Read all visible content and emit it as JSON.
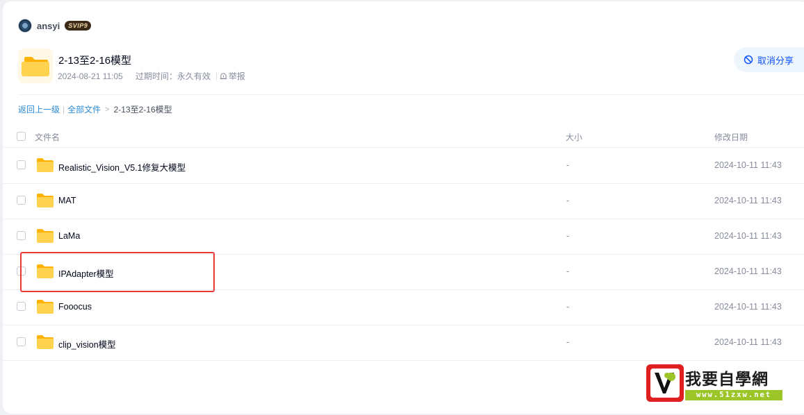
{
  "user": {
    "name": "ansyi",
    "vip_badge": "SVIP9"
  },
  "share": {
    "title": "2-13至2-16模型",
    "date": "2024-08-21 11:05",
    "expire": "过期时间：永久有效",
    "report": "举报",
    "cancel_label": "取消分享"
  },
  "breadcrumb": {
    "back": "返回上一级",
    "all_files": "全部文件",
    "current": "2-13至2-16模型"
  },
  "table": {
    "columns": {
      "name": "文件名",
      "size": "大小",
      "date": "修改日期"
    },
    "rows": [
      {
        "name": "Realistic_Vision_V5.1修复大模型",
        "size": "-",
        "date": "2024-10-11 11:43"
      },
      {
        "name": "MAT",
        "size": "-",
        "date": "2024-10-11 11:43"
      },
      {
        "name": "LaMa",
        "size": "-",
        "date": "2024-10-11 11:43"
      },
      {
        "name": "IPAdapter模型",
        "size": "-",
        "date": "2024-10-11 11:43"
      },
      {
        "name": "Fooocus",
        "size": "-",
        "date": "2024-10-11 11:43"
      },
      {
        "name": "clip_vision模型",
        "size": "-",
        "date": "2024-10-11 11:43"
      }
    ]
  },
  "watermark": {
    "text": "我要自學網",
    "url": "www.51zxw.net"
  },
  "colors": {
    "accent": "#0d53ff",
    "link": "#2a8bd8",
    "folder": "#ffc53d",
    "highlight_box": "#e53935"
  },
  "icons": {
    "avatar": "avatar-image",
    "folder": "folder-icon",
    "cancel": "ban-icon",
    "report": "alert-icon"
  }
}
